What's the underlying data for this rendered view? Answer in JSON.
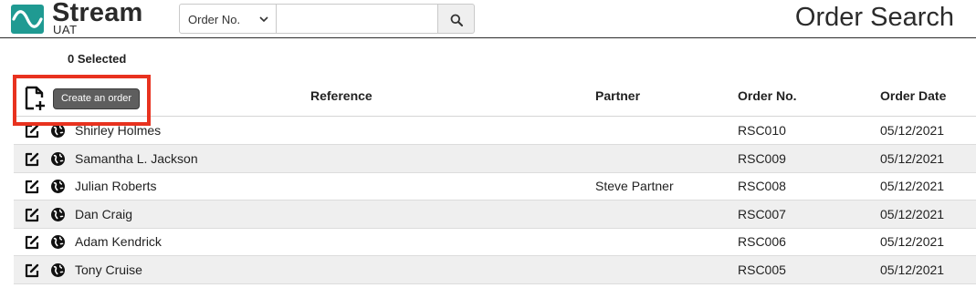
{
  "app": {
    "name": "Stream",
    "env": "UAT"
  },
  "search": {
    "type_selected": "Order No.",
    "input_value": "",
    "input_placeholder": ""
  },
  "page_title": "Order Search",
  "selected_label": "0 Selected",
  "toolbar": {
    "create_order_label": "Create an order"
  },
  "table": {
    "headers": {
      "reference": "Reference",
      "partner": "Partner",
      "order_no": "Order No.",
      "order_date": "Order Date"
    },
    "rows": [
      {
        "name": "Shirley Holmes",
        "partner": "",
        "order_no": "RSC010",
        "order_date": "05/12/2021"
      },
      {
        "name": "Samantha L. Jackson",
        "partner": "",
        "order_no": "RSC009",
        "order_date": "05/12/2021"
      },
      {
        "name": "Julian Roberts",
        "partner": "Steve Partner",
        "order_no": "RSC008",
        "order_date": "05/12/2021"
      },
      {
        "name": "Dan Craig",
        "partner": "",
        "order_no": "RSC007",
        "order_date": "05/12/2021"
      },
      {
        "name": "Adam Kendrick",
        "partner": "",
        "order_no": "RSC006",
        "order_date": "05/12/2021"
      },
      {
        "name": "Tony Cruise",
        "partner": "",
        "order_no": "RSC005",
        "order_date": "05/12/2021"
      }
    ]
  },
  "colors": {
    "brand": "#1f9a92",
    "highlight": "#e8321f",
    "row_alt": "#efefef",
    "button": "#5e5e5e"
  },
  "icons": [
    "stream-logo-icon",
    "chevron-down-icon",
    "search-icon",
    "new-document-icon",
    "edit-icon",
    "globe-icon"
  ]
}
